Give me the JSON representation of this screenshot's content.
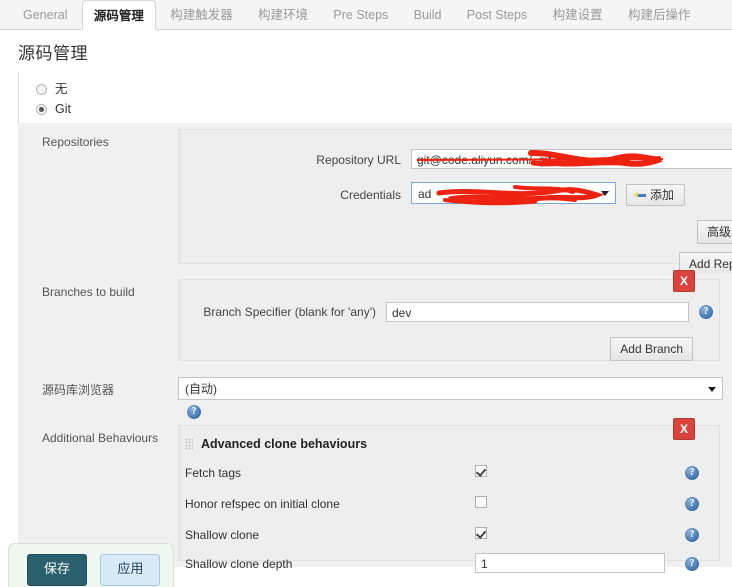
{
  "tabs": [
    {
      "label": "General",
      "active": false
    },
    {
      "label": "源码管理",
      "active": true
    },
    {
      "label": "构建触发器",
      "active": false
    },
    {
      "label": "构建环境",
      "active": false
    },
    {
      "label": "Pre Steps",
      "active": false
    },
    {
      "label": "Build",
      "active": false
    },
    {
      "label": "Post Steps",
      "active": false
    },
    {
      "label": "构建设置",
      "active": false
    },
    {
      "label": "构建后操作",
      "active": false
    }
  ],
  "page": {
    "title": "源码管理"
  },
  "scm_choice": {
    "none_label": "无",
    "git_label": "Git",
    "selected": "Git"
  },
  "repositories": {
    "section_label": "Repositories",
    "url_label": "Repository URL",
    "url_value": "git@code.aliyun.com/            .git",
    "credentials_label": "Credentials",
    "credentials_value": "ad                          ",
    "add_credentials_label": "添加",
    "advanced_label": "高级...",
    "add_repository_label": "Add Repository"
  },
  "branches": {
    "section_label": "Branches to build",
    "specifier_label": "Branch Specifier (blank for 'any')",
    "specifier_value": "dev",
    "add_branch_label": "Add Branch",
    "delete_label": "X"
  },
  "repo_browser": {
    "section_label": "源码库浏览器",
    "selected_value": "(自动)"
  },
  "additional_behaviours": {
    "section_label": "Additional Behaviours",
    "group_title": "Advanced clone behaviours",
    "delete_label": "X",
    "rows": [
      {
        "label": "Fetch tags",
        "type": "checkbox",
        "checked": true
      },
      {
        "label": "Honor refspec on initial clone",
        "type": "checkbox",
        "checked": false
      },
      {
        "label": "Shallow clone",
        "type": "checkbox",
        "checked": true
      },
      {
        "label": "Shallow clone depth",
        "type": "text",
        "value": "1"
      }
    ]
  },
  "footer": {
    "save_label": "保存",
    "apply_label": "应用"
  },
  "icons": {
    "help": "?"
  },
  "colors": {
    "accent_red": "#d9453d",
    "save_bg": "#2a5f6e",
    "apply_bg": "#d9eaf7",
    "panel_bg": "#eeeeee",
    "redaction": "#ee1111"
  }
}
